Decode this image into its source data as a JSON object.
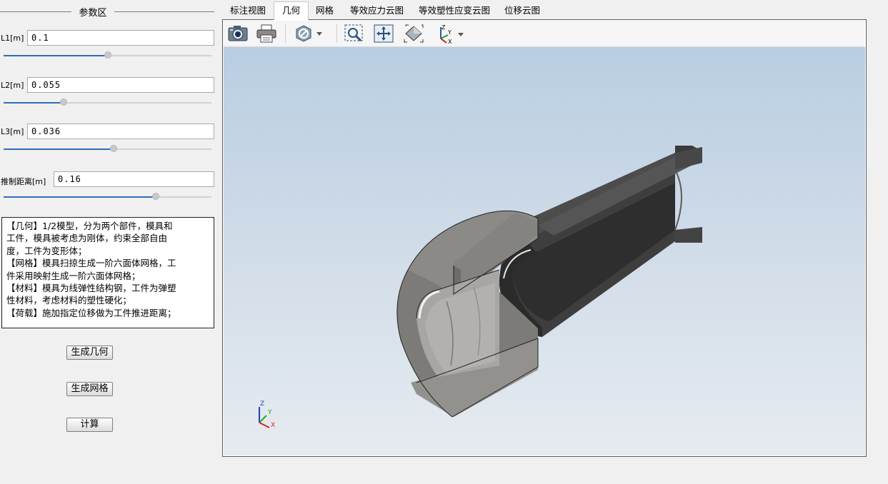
{
  "params": {
    "group_title": "参数区",
    "fields": [
      {
        "label": "L1[m]",
        "value": "0.1",
        "slider_fraction": 0.5
      },
      {
        "label": "L2[m]",
        "value": "0.055",
        "slider_fraction": 0.28
      },
      {
        "label": "L3[m]",
        "value": "0.036",
        "slider_fraction": 0.53
      },
      {
        "label": "推制距离[m]",
        "value": "0.16",
        "slider_fraction": 0.74
      }
    ]
  },
  "description": [
    "【几何】1/2模型，分为两个部件，模具和",
    "工件，模具被考虑为刚体，约束全部自由",
    "度，工件为变形体；",
    "【网格】模具扫掠生成一阶六面体网格，工",
    "件采用映射生成一阶六面体网格；",
    "【材料】模具为线弹性结构钢，工件为弹塑",
    "性材料，考虑材料的塑性硬化；",
    "【荷载】施加指定位移做为工件推进距离；"
  ],
  "buttons": {
    "gen_geometry": "生成几何",
    "gen_mesh": "生成网格",
    "compute": "计算"
  },
  "tabs": [
    {
      "label": "标注视图",
      "active": false
    },
    {
      "label": "几何",
      "active": true
    },
    {
      "label": "网格",
      "active": false
    },
    {
      "label": "等效应力云图",
      "active": false
    },
    {
      "label": "等效塑性应变云图",
      "active": false
    },
    {
      "label": "位移云图",
      "active": false
    }
  ],
  "toolbar": {
    "icons": [
      "camera-icon",
      "printer-icon",
      "no-symbol-icon",
      "zoom-fit-icon",
      "pan-icon",
      "view-cube-icon",
      "axes-icon"
    ]
  },
  "axes_triad": {
    "x": "X",
    "y": "Y",
    "z": "Z"
  },
  "colors": {
    "accent": "#2f6fb5",
    "axis_x": "#e02020",
    "axis_y": "#20b020",
    "axis_z": "#2040d0"
  }
}
